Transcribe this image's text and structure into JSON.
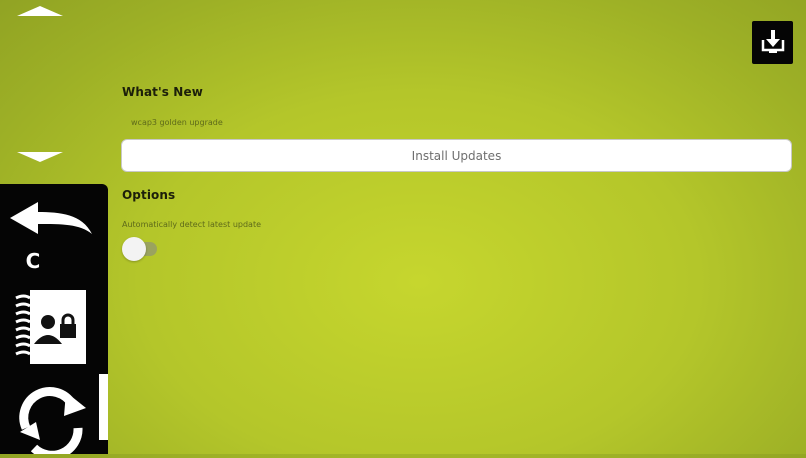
{
  "whats_new": {
    "title": "What's New",
    "description": "wcap3 golden upgrade",
    "install_label": "Install Updates"
  },
  "options": {
    "title": "Options",
    "auto_detect_label": "Automatically detect latest update",
    "auto_detect_enabled": false
  },
  "sidebar": {
    "items": [
      {
        "icon": "scroll-up-icon"
      },
      {
        "icon": "scroll-down-icon"
      },
      {
        "icon": "back-arrow-icon"
      },
      {
        "icon": "c-letter-icon",
        "label": "C"
      },
      {
        "icon": "contact-book-lock-icon"
      },
      {
        "icon": "refresh-icon"
      }
    ]
  },
  "toolbar": {
    "download_icon": "download-to-device-icon"
  },
  "colors": {
    "background_center": "#c6d62e",
    "background_edge": "#8ea023",
    "rail": "#050505",
    "button_bg": "#ffffff",
    "button_text": "#6e6e6e"
  }
}
